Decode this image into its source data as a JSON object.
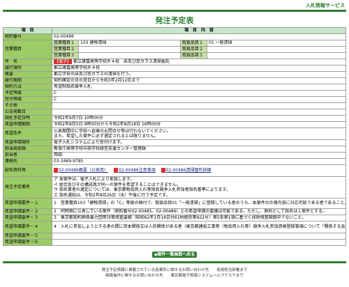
{
  "header": {
    "service_link": "入札情報サービス"
  },
  "page_title": "発注予定表",
  "table_header": {
    "col1": "項　目",
    "col2": "項　目　内　容"
  },
  "rows": {
    "keiyaku_no": {
      "label": "契約番号",
      "value": "02-00486"
    },
    "eigyo": {
      "label": "営業種目",
      "s1": {
        "label": "営業種目１",
        "value": "103 建物清掃"
      },
      "s2": {
        "label": "営業種目２",
        "value": ""
      },
      "s3": {
        "label": "営業種目３",
        "value": ""
      },
      "t1": {
        "label": "取扱品目１",
        "value": "01 一般清掃"
      },
      "t2": {
        "label": "取扱品目２",
        "value": ""
      },
      "t3": {
        "label": "取扱品目３",
        "value": ""
      }
    },
    "kenmei": {
      "label": "件　名",
      "badge": "【電子】",
      "value": "都立護富高等学校外４校　床及び窓ガラス清掃委託"
    },
    "basho": {
      "label": "履行場所",
      "value": "都立護富高等学校外４校"
    },
    "gaiyo": {
      "label": "概要",
      "value": "都立学校の床及び窓ガラスの清掃を行う。"
    },
    "kikan": {
      "label": "履行期間",
      "value": "契約確定の日の翌日から令和3年2月12日まで"
    },
    "hoshiki": {
      "label": "契約方法",
      "value": "希望制指名競争入札"
    },
    "yotei": {
      "label": "予定等級",
      "value": "C"
    },
    "juri": {
      "label": "受付等級",
      "value": "C"
    },
    "sonota": {
      "label": "その他",
      "value": ""
    },
    "kokoku": {
      "label": "公告掲載日",
      "value": ""
    },
    "kaisatsu": {
      "label": "開札予定日時",
      "value": "令和2年9月7日 10時00分"
    },
    "uketsuke": {
      "label": "希望申請期間",
      "value": "令和2年8月5日 9時00分から令和2年8月18日 16時00分"
    },
    "jouken": {
      "label": "希望条件",
      "line1": "公表期間中に学校へ倉庫のお問合せ等は行わないでください。",
      "line2": "また、希望した案件に必ず選定されるとは限りません。"
    },
    "basho2": {
      "label": "希望申請場所",
      "value": "電子入札システムにより受付けます。"
    },
    "tanto": {
      "label": "担当局部課",
      "value": "教育庁高等学校中部学校経営支援センター管理課"
    },
    "tantosha": {
      "label": "担当者",
      "value": "西田"
    },
    "renraku": {
      "label": "連絡先",
      "value": "03-3469-9785"
    },
    "shiryo": {
      "label": "配布資料等",
      "att1": "02-00486概要（公表用）",
      "att2": "02-00486注意事項",
      "att3": "02-00486清掃箇所詳細"
    },
    "setsumei": {
      "label": "発注予定備考",
      "line1": "ア 本案件は、電子入札により実施します。",
      "line2": "イ 組合及びその構成員が同一の案件を希望することはできません。",
      "line3": "ウ 指名業者の選定については、東京都物品買入れ等指名競争入札参加者指名基準によります。",
      "line4": "エ 指名通知は、令和2年8月26日（水）午後に行う予定です。"
    },
    "y1": {
      "label": "希望申請要件－１",
      "value": "1　営業種目103「建物清掃」の「C」等級の格付で、取扱品目01「一般清掃」に登録している者のうち、本案件の仕様内容に対応可能である者であること。"
    },
    "y2": {
      "label": "希望申請要件－２",
      "value": "2　同時期に公表している案件（契約番号02-00485、02-00486）との希望申請の重複は可能である。ただし、原則として指名は１案件とする。"
    },
    "y3": {
      "label": "希望申請要件－３",
      "value": "3　東京都契約関係暴力団等対策措置要綱（昭和62年1月14日付61財経庶第922号）第5条第1項に基づく排除措置期間中でないこと。"
    },
    "y4": {
      "label": "希望申請要件－４",
      "value": "4　入札に参加しようとする者の間に資本関係又は人的関係がある者（東京都建設工事等（物品買入れ等）競争入札参加資格登録事項について「関係する会社」に該当する者）は入札に参加できない。"
    },
    "y5": {
      "label": "希望申請要件－５",
      "value": ""
    },
    "y6": {
      "label": "希望申請要件－６",
      "value": ""
    }
  },
  "back_button": "◆案件一覧画面へ戻る",
  "footer": {
    "line1": "発注予定情報に掲載されている各案件に関するお問い合わせ先　　各局担当部署まで",
    "line2": "画面操作に関するお問い合わせ先　　東京都電子調達システムヘルプデスクまで"
  }
}
